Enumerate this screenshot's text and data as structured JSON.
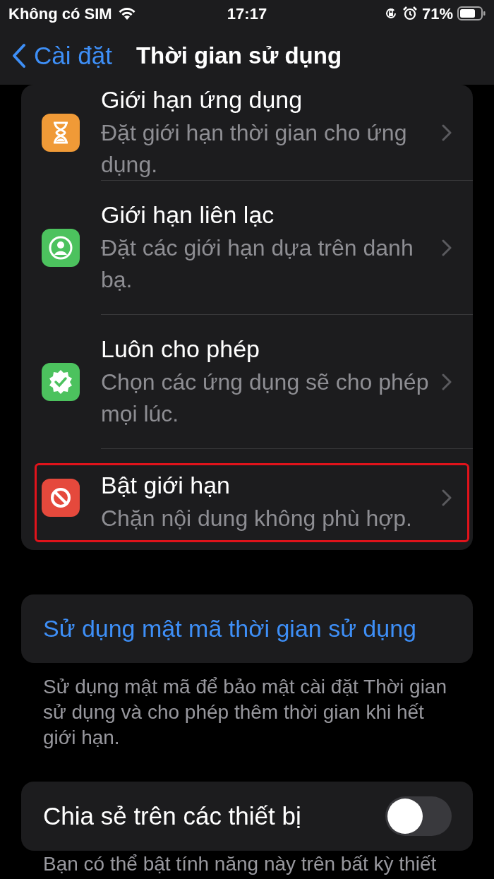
{
  "status_bar": {
    "carrier": "Không có SIM",
    "time": "17:17",
    "battery_percent": "71%"
  },
  "nav": {
    "back": "Cài đặt",
    "title": "Thời gian sử dụng"
  },
  "rows": [
    {
      "title": "Giới hạn ứng dụng",
      "subtitle": "Đặt giới hạn thời gian cho ứng dụng.",
      "kind": "hourglass",
      "color": "#f09a37",
      "highlighted": false
    },
    {
      "title": "Giới hạn liên lạc",
      "subtitle": "Đặt các giới hạn dựa trên danh bạ.",
      "kind": "person",
      "color": "#4cc25e",
      "highlighted": false
    },
    {
      "title": "Luôn cho phép",
      "subtitle": "Chọn các ứng dụng sẽ cho phép mọi lúc.",
      "kind": "badge",
      "color": "#4cc25e",
      "highlighted": false
    },
    {
      "title": "Bật giới hạn",
      "subtitle": "Chặn nội dung không phù hợp.",
      "kind": "block",
      "color": "#e5493c",
      "highlighted": true
    }
  ],
  "passcode_button": "Sử dụng mật mã thời gian sử dụng",
  "passcode_note": "Sử dụng mật mã để bảo mật cài đặt Thời gian sử dụng và cho phép thêm thời gian khi hết giới hạn.",
  "share": {
    "label": "Chia sẻ trên các thiết bị",
    "on": false
  },
  "share_note": "Bạn có thể bật tính năng này trên bất kỳ thiết"
}
